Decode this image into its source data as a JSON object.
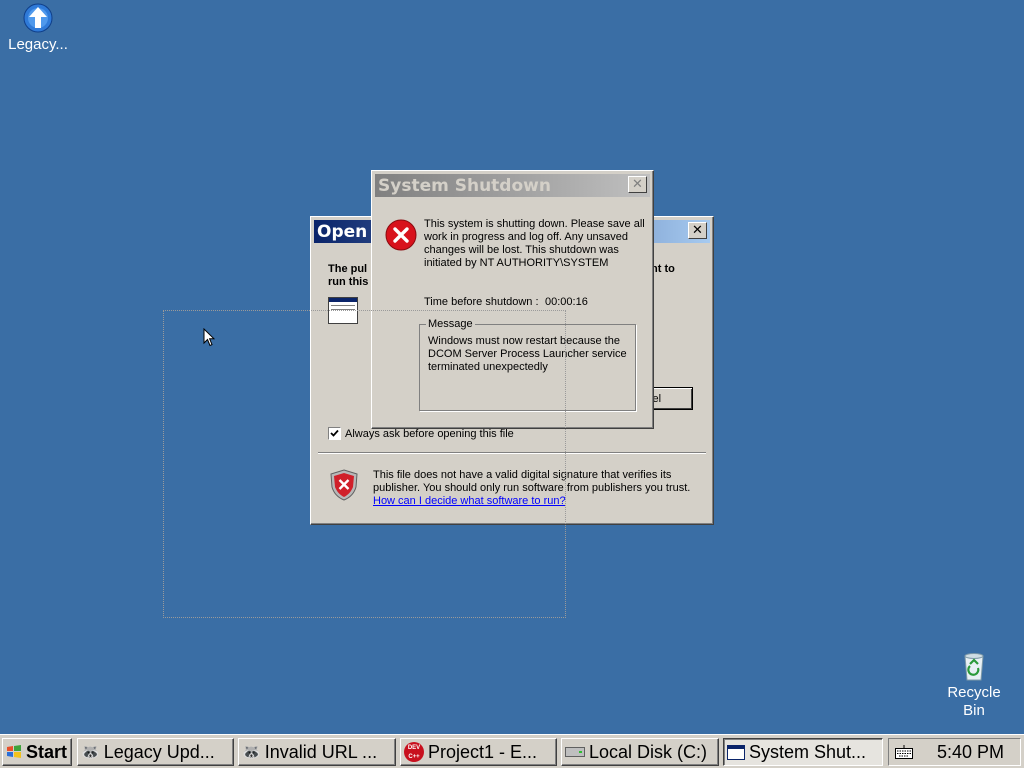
{
  "desktop": {
    "icons": [
      {
        "label": "Legacy..."
      },
      {
        "label": "Recycle Bin"
      }
    ]
  },
  "open_dialog": {
    "title": "Open",
    "prompt_line1": "The pul",
    "prompt_line1_tail": "nt to",
    "prompt_line2": "run this",
    "cancel_label": "ncel",
    "checkbox_label": "Always ask before opening this file",
    "checkbox_checked": true,
    "security_text_line1": "This file does not have a valid digital signature that verifies its",
    "security_text_line2": "publisher.  You should only run software from publishers you trust.",
    "help_link": "How can I decide what software to run?"
  },
  "shutdown_dialog": {
    "title": "System Shutdown",
    "body_line1": "This system is shutting down. Please save all",
    "body_line2": "work in progress and log off. Any unsaved",
    "body_line3": "changes will be lost. This shutdown was",
    "body_line4": "initiated by NT AUTHORITY\\SYSTEM",
    "time_label": "Time before shutdown :",
    "time_value": "00:00:16",
    "message_group_label": "Message",
    "message_line1": "Windows must now restart because the",
    "message_line2": "DCOM Server Process Launcher service",
    "message_line3": "terminated unexpectedly"
  },
  "taskbar": {
    "start_label": "Start",
    "buttons": [
      {
        "label": "Legacy Upd..."
      },
      {
        "label": "Invalid URL ..."
      },
      {
        "label": "Project1 - E..."
      },
      {
        "label": "Local Disk (C:)"
      },
      {
        "label": "System Shut..."
      }
    ],
    "clock": "5:40 PM"
  }
}
